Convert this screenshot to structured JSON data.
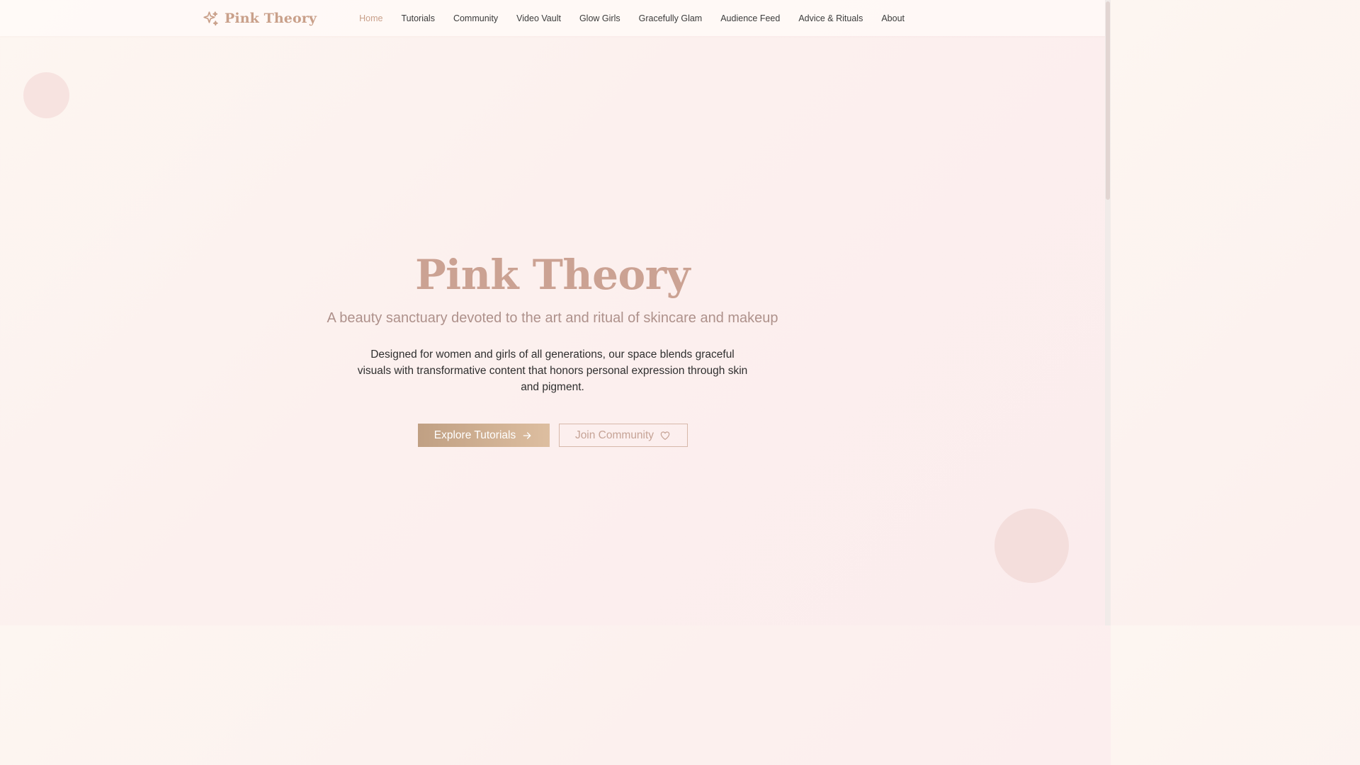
{
  "brand": {
    "name": "Pink Theory",
    "logo_icon": "sparkles-icon",
    "accent_color": "#c9a08a"
  },
  "nav": {
    "items": [
      {
        "label": "Home",
        "active": true
      },
      {
        "label": "Tutorials",
        "active": false
      },
      {
        "label": "Community",
        "active": false
      },
      {
        "label": "Video Vault",
        "active": false
      },
      {
        "label": "Glow Girls",
        "active": false
      },
      {
        "label": "Gracefully Glam",
        "active": false
      },
      {
        "label": "Audience Feed",
        "active": false
      },
      {
        "label": "Advice & Rituals",
        "active": false
      },
      {
        "label": "About",
        "active": false
      }
    ]
  },
  "hero": {
    "title": "Pink Theory",
    "subtitle": "A beauty sanctuary devoted to the art and ritual of skincare and makeup",
    "description": "Designed for women and girls of all generations, our space blends graceful visuals with transformative content that honors personal expression through skin and pigment.",
    "primary_button": {
      "label": "Explore Tutorials",
      "icon": "arrow-right-icon"
    },
    "secondary_button": {
      "label": "Join Community",
      "icon": "heart-icon"
    }
  }
}
